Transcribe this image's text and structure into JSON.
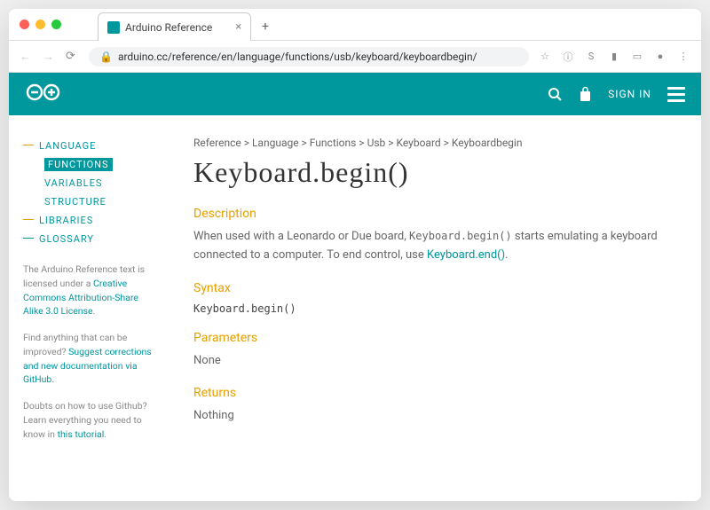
{
  "browser": {
    "tab_title": "Arduino Reference",
    "url": "arduino.cc/reference/en/language/functions/usb/keyboard/keyboardbegin/"
  },
  "header": {
    "signin": "SIGN IN"
  },
  "sidebar": {
    "nav": {
      "language": "LANGUAGE",
      "functions": "FUNCTIONS",
      "variables": "VARIABLES",
      "structure": "STRUCTURE",
      "libraries": "LIBRARIES",
      "glossary": "GLOSSARY"
    },
    "note1_pre": "The Arduino Reference text is licensed under a ",
    "note1_link": "Creative Commons Attribution-Share Alike 3.0 License",
    "note1_post": ".",
    "note2_pre": "Find anything that can be improved? ",
    "note2_link": "Suggest corrections and new documentation via GitHub",
    "note2_post": ".",
    "note3_pre": "Doubts on how to use Github? Learn everything you need to know in ",
    "note3_link": "this tutorial",
    "note3_post": "."
  },
  "main": {
    "breadcrumb": "Reference > Language > Functions > Usb > Keyboard > Keyboardbegin",
    "title": "Keyboard.begin()",
    "desc_h": "Description",
    "desc_1": "When used with a Leonardo or Due board, ",
    "desc_code": "Keyboard.begin()",
    "desc_2": " starts emulating a keyboard connected to a computer. To end control, use ",
    "desc_link": "Keyboard.end()",
    "desc_3": ".",
    "syntax_h": "Syntax",
    "syntax_code": "Keyboard.begin()",
    "params_h": "Parameters",
    "params_v": "None",
    "returns_h": "Returns",
    "returns_v": "Nothing"
  }
}
